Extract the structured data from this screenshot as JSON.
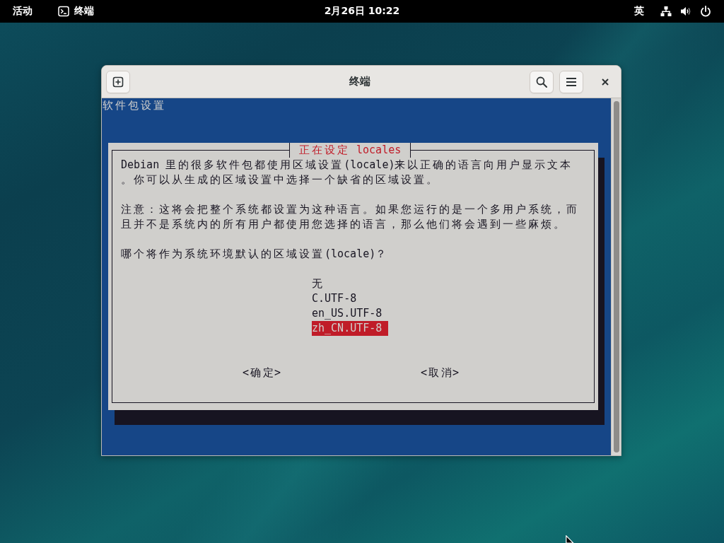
{
  "top_bar": {
    "activities": "活动",
    "app_menu": "终端",
    "clock": "2月26日 10:22",
    "input_method": "英"
  },
  "window": {
    "title": "终端",
    "terminal": {
      "heading": "软件包设置",
      "dialog": {
        "title": "正在设定 locales",
        "paragraphs": [
          [
            "Debian 里的很多软件包都使用区域设置(locale)来以正确的语言向用户显示文本",
            "。你可以从生成的区域设置中选择一个缺省的区域设置。"
          ],
          [
            "注意：这将会把整个系统都设置为这种语言。如果您运行的是一个多用户系统，而",
            "且并不是系统内的所有用户都使用您选择的语言，那么他们将会遇到一些麻烦。"
          ],
          [
            "哪个将作为系统环境默认的区域设置(locale)？"
          ]
        ],
        "options": [
          {
            "label": "无",
            "selected": false
          },
          {
            "label": "C.UTF-8",
            "selected": false
          },
          {
            "label": "en_US.UTF-8",
            "selected": false
          },
          {
            "label": "zh_CN.UTF-8",
            "selected": true
          }
        ],
        "buttons": [
          "<确定>",
          "<取消>"
        ]
      }
    }
  }
}
